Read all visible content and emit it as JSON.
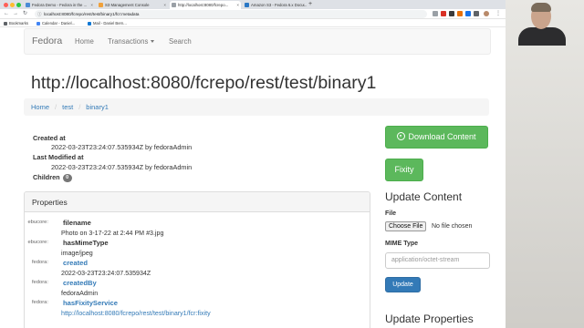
{
  "browser": {
    "tabs": [
      {
        "title": "Fedora Demo - Fedora in the ...",
        "favicon_color": "#4a8bd6",
        "active": false
      },
      {
        "title": "S3 Management Console",
        "favicon_color": "#f0a13b",
        "active": false
      },
      {
        "title": "http://localhost:8080/fcrepo...",
        "favicon_color": "#9aa0a6",
        "active": true
      },
      {
        "title": "Amazon S3 - Fedora 6.x Docu...",
        "favicon_color": "#2b78c5",
        "active": false
      }
    ],
    "url": "localhost:8080/fcrepo/rest/test/binary1/fcr:metadata",
    "bookmarks": [
      {
        "label": "Bookmarks",
        "color": "#5f6368"
      },
      {
        "label": "Calendar - Daniel...",
        "color": "#4285f4"
      },
      {
        "label": "Mail - Daniel Bern...",
        "color": "#0f78d4"
      }
    ]
  },
  "navbar": {
    "brand": "Fedora",
    "home": "Home",
    "transactions": "Transactions",
    "search": "Search"
  },
  "page_title": "http://localhost:8080/fcrepo/rest/test/binary1",
  "breadcrumb": [
    "Home",
    "test",
    "binary1"
  ],
  "meta": {
    "created_label": "Created at",
    "created_value": "2022-03-23T23:24:07.535934Z by fedoraAdmin",
    "modified_label": "Last Modified at",
    "modified_value": "2022-03-23T23:24:07.535934Z by fedoraAdmin",
    "children_label": "Children",
    "children_count": "0"
  },
  "properties": {
    "heading": "Properties",
    "items": [
      {
        "ns": "ebucore:",
        "name": "filename",
        "value": "Photo on 3-17-22 at 2:44 PM #3.jpg",
        "name_link": false,
        "value_link": false
      },
      {
        "ns": "ebucore:",
        "name": "hasMimeType",
        "value": "image/jpeg",
        "name_link": false,
        "value_link": false
      },
      {
        "ns": "fedora:",
        "name": "created",
        "value": "2022-03-23T23:24:07.535934Z",
        "name_link": true,
        "value_link": false
      },
      {
        "ns": "fedora:",
        "name": "createdBy",
        "value": "fedoraAdmin",
        "name_link": true,
        "value_link": false
      },
      {
        "ns": "fedora:",
        "name": "hasFixityService",
        "value": "http://localhost:8080/fcrepo/rest/test/binary1/fcr:fixity",
        "name_link": true,
        "value_link": true
      }
    ]
  },
  "sidebar": {
    "download_label": "Download Content",
    "fixity_label": "Fixity",
    "update_content_heading": "Update Content",
    "file_label": "File",
    "choose_file_label": "Choose File",
    "no_file_text": "No file chosen",
    "mime_label": "MIME Type",
    "mime_placeholder": "application/octet-stream",
    "update_button": "Update",
    "update_properties_heading": "Update Properties"
  },
  "colors": {
    "success": "#5cb85c",
    "primary": "#337ab7",
    "link": "#337ab7"
  }
}
